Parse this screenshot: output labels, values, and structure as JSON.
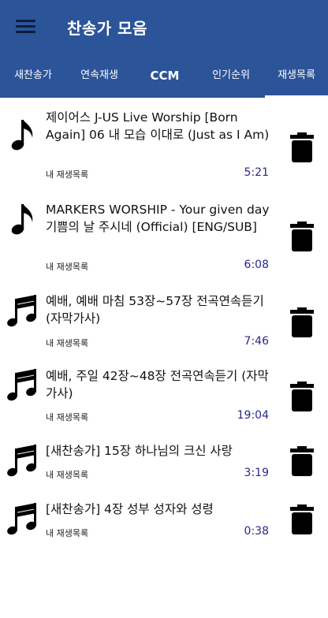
{
  "app": {
    "title": "찬송가 모음"
  },
  "tabs": [
    {
      "label": "새찬송가"
    },
    {
      "label": "연속재생"
    },
    {
      "label": "CCM"
    },
    {
      "label": "인기순위"
    },
    {
      "label": "재생목록"
    }
  ],
  "playlist": [
    {
      "title": "제이어스 J-US Live Worship [Born Again] 06 내 모습 이대로 (Just as I Am)",
      "source": "내 재생목록",
      "duration": "5:21",
      "icon": "eighth-note-icon"
    },
    {
      "title": "MARKERS WORSHIP - Your given day 기쁨의 날 주시네 (Official) [ENG/SUB]",
      "source": "내 재생목록",
      "duration": "6:08",
      "icon": "eighth-note-icon"
    },
    {
      "title": " 예배, 예배 마침 53장~57장 전곡연속듣기 (자막가사)",
      "source": "내 재생목록",
      "duration": "7:46",
      "icon": "double-note-icon"
    },
    {
      "title": " 예배, 주일 42장~48장 전곡연속듣기 (자막가사)",
      "source": "내 재생목록",
      "duration": "19:04",
      "icon": "double-note-icon"
    },
    {
      "title": "[새찬송가] 15장 하나님의 크신 사랑",
      "source": "내 재생목록",
      "duration": "3:19",
      "icon": "double-note-icon"
    },
    {
      "title": "[새찬송가] 4장 성부 성자와 성령",
      "source": "내 재생목록",
      "duration": "0:38",
      "icon": "double-note-icon"
    }
  ],
  "colors": {
    "appbar": "#2b5499",
    "duration_text": "#27288a",
    "icon": "#000000"
  }
}
